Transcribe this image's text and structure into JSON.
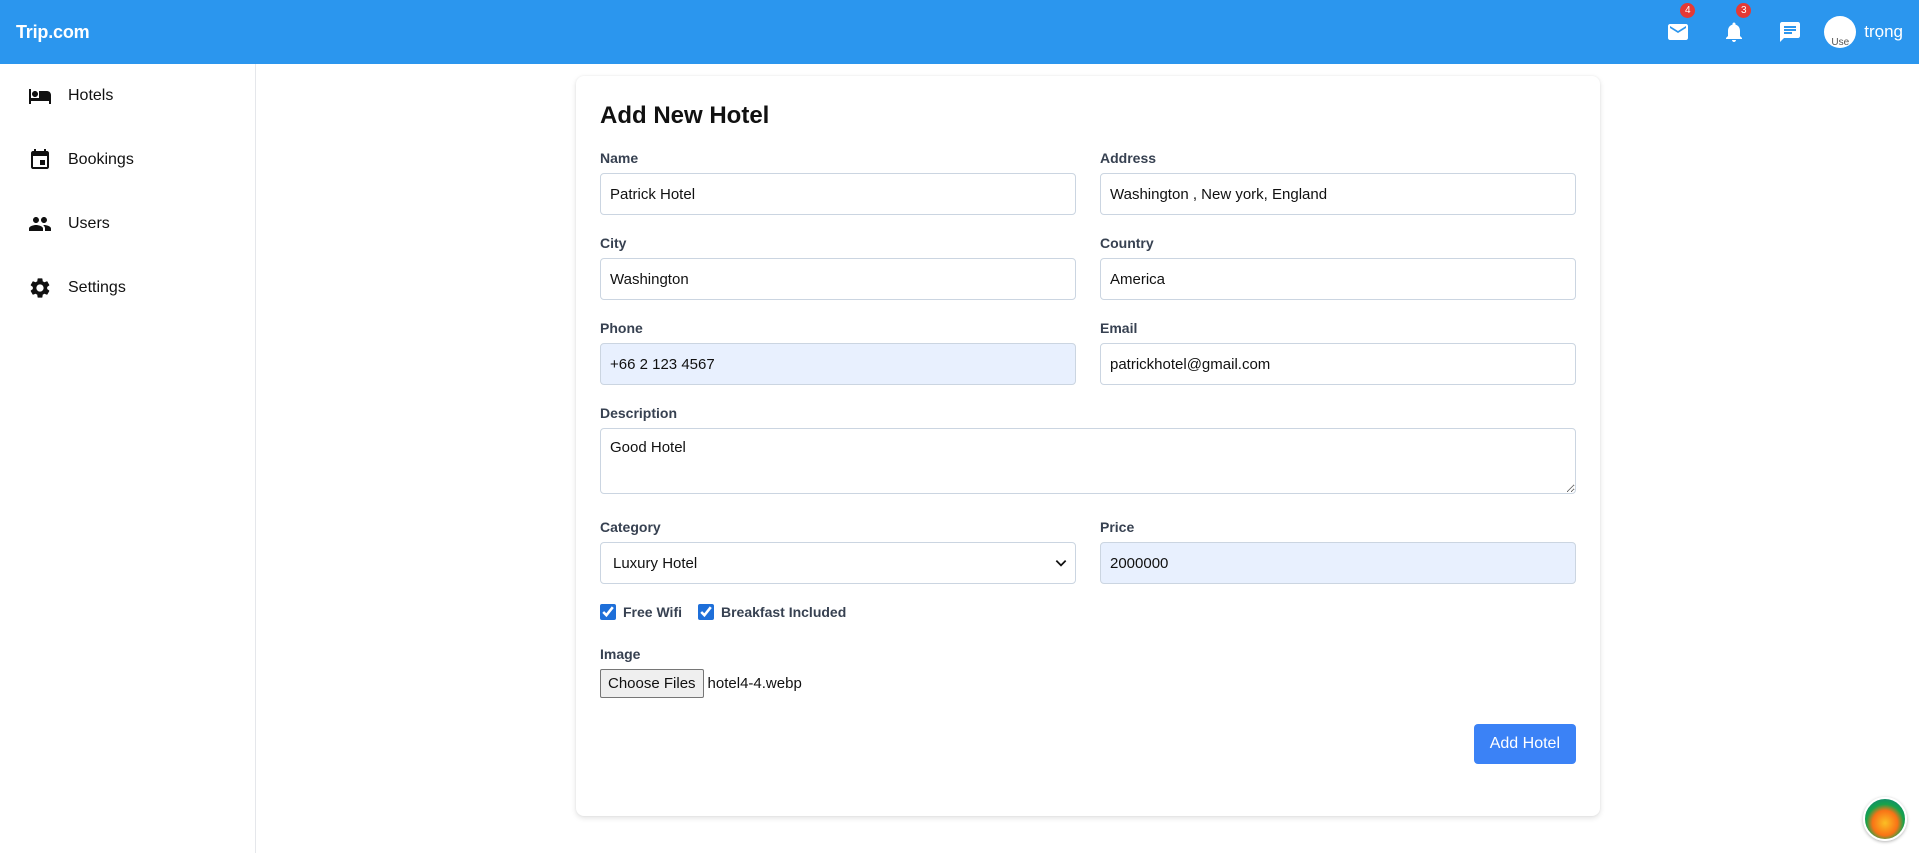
{
  "app": {
    "brand": "Trip.com"
  },
  "topbar": {
    "mail_count": "4",
    "notif_count": "3",
    "avatar_alt": "Use",
    "username": "trọng"
  },
  "sidebar": {
    "items": [
      {
        "label": "Hotels",
        "icon": "bed-icon"
      },
      {
        "label": "Bookings",
        "icon": "calendar-icon"
      },
      {
        "label": "Users",
        "icon": "users-icon"
      },
      {
        "label": "Settings",
        "icon": "gear-icon"
      }
    ]
  },
  "form": {
    "title": "Add New Hotel",
    "name": {
      "label": "Name",
      "value": "Patrick Hotel"
    },
    "address": {
      "label": "Address",
      "value": "Washington , New york, England"
    },
    "city": {
      "label": "City",
      "value": "Washington"
    },
    "country": {
      "label": "Country",
      "value": "America"
    },
    "phone": {
      "label": "Phone",
      "value": "+66 2 123 4567"
    },
    "email": {
      "label": "Email",
      "value": "patrickhotel@gmail.com"
    },
    "description": {
      "label": "Description",
      "value": "Good Hotel"
    },
    "category": {
      "label": "Category",
      "value": "Luxury Hotel"
    },
    "price": {
      "label": "Price",
      "value": "2000000"
    },
    "wifi_label": "Free Wifi",
    "breakfast_label": "Breakfast Included",
    "image": {
      "label": "Image",
      "button": "Choose Files",
      "file_name": "hotel4-4.webp"
    },
    "submit_label": "Add Hotel"
  },
  "colors": {
    "topbar": "#2b96ee",
    "primary": "#3b82f6",
    "badge": "#e53935"
  }
}
